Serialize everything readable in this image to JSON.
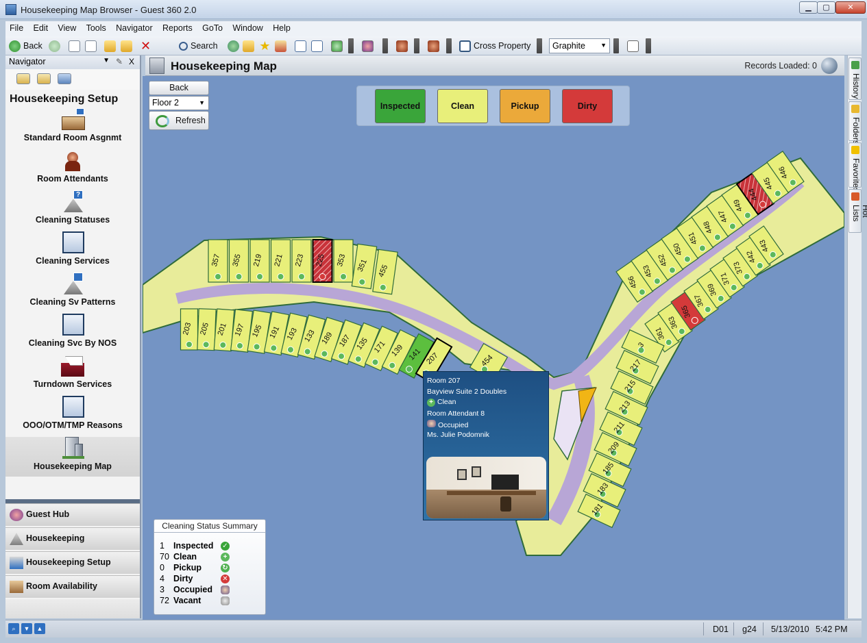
{
  "window": {
    "title": "Housekeeping Map Browser - Guest 360 2.0",
    "minimize": "▁",
    "maximize": "▢",
    "close": "✕"
  },
  "menu": [
    "File",
    "Edit",
    "View",
    "Tools",
    "Navigator",
    "Reports",
    "GoTo",
    "Window",
    "Help"
  ],
  "toolbar": {
    "back_label": "Back",
    "search_label": "Search",
    "property_label": "Cross Property",
    "theme_value": "Graphite"
  },
  "navigator": {
    "title": "Navigator",
    "close": "X",
    "section_title": "Housekeeping Setup",
    "items": [
      {
        "label": "Standard Room Asgnmt",
        "icon": "bed-icon"
      },
      {
        "label": "Room Attendants",
        "icon": "attendant-icon"
      },
      {
        "label": "Cleaning Statuses",
        "icon": "cleaning-status-icon"
      },
      {
        "label": "Cleaning Services",
        "icon": "cleaning-services-icon"
      },
      {
        "label": "Cleaning Sv Patterns",
        "icon": "cleaning-patterns-icon"
      },
      {
        "label": "Cleaning Svc By NOS",
        "icon": "cleaning-nos-icon"
      },
      {
        "label": "Turndown Services",
        "icon": "turndown-icon"
      },
      {
        "label": "OOO/OTM/TMP  Reasons",
        "icon": "reasons-icon"
      },
      {
        "label": "Housekeeping Map",
        "icon": "building-icon"
      }
    ],
    "groups": [
      {
        "label": "Guest Hub",
        "icon": "guest-hub-icon"
      },
      {
        "label": "Housekeeping",
        "icon": "housekeeping-icon"
      },
      {
        "label": "Housekeeping Setup",
        "icon": "housekeeping-setup-icon"
      },
      {
        "label": "Room Availability",
        "icon": "room-availability-icon"
      }
    ]
  },
  "main": {
    "title": "Housekeeping Map",
    "records_loaded": "Records Loaded: 0",
    "back_label": "Back",
    "floor_value": "Floor 2",
    "refresh_label": "Refresh"
  },
  "legend": [
    {
      "label": "Inspected",
      "color": "#3aa53a"
    },
    {
      "label": "Clean",
      "color": "#e8ef7a"
    },
    {
      "label": "Pickup",
      "color": "#eba93a"
    },
    {
      "label": "Dirty",
      "color": "#d43a3a"
    }
  ],
  "tooltip": {
    "room": "Room 207",
    "room_type": "Bayview Suite 2 Doubles",
    "status": "Clean",
    "attendant": "Room Attendant 8",
    "occupancy": "Occupied",
    "guest": "Ms. Julie Podomnik"
  },
  "summary": {
    "title": "Cleaning Status Summary",
    "rows": [
      {
        "count": "1",
        "label": "Inspected",
        "icon": "check-icon"
      },
      {
        "count": "70",
        "label": "Clean",
        "icon": "plus-icon"
      },
      {
        "count": "0",
        "label": "Pickup",
        "icon": "cycle-icon"
      },
      {
        "count": "4",
        "label": "Dirty",
        "icon": "x-icon"
      },
      {
        "count": "3",
        "label": "Occupied",
        "icon": "people-icon"
      },
      {
        "count": "72",
        "label": "Vacant",
        "icon": "vacant-icon"
      }
    ]
  },
  "right_tabs": [
    "History",
    "Folders",
    "Favorites",
    "Hot Lists"
  ],
  "status_bar": {
    "code": "D01",
    "user": "g24",
    "date": "5/13/2010",
    "time": "5:42 PM"
  },
  "rooms": {
    "upper_left": [
      "357",
      "355",
      "219",
      "221",
      "223",
      "225",
      "353",
      "351",
      "455"
    ],
    "lower_left": [
      "203",
      "205",
      "201",
      "197",
      "195",
      "191",
      "193",
      "133",
      "189",
      "187",
      "135",
      "171",
      "139",
      "141",
      "207"
    ],
    "middle": [
      "454"
    ],
    "right_outer": [
      "456",
      "453",
      "452",
      "450",
      "451",
      "448",
      "447",
      "449",
      "444",
      "445",
      "446"
    ],
    "right_inner": [
      "361",
      "363",
      "365",
      "367",
      "369",
      "371",
      "373",
      "442",
      "443"
    ],
    "lower_right": [
      "3",
      "217",
      "215",
      "213",
      "211",
      "209",
      "185",
      "183",
      "181"
    ]
  }
}
